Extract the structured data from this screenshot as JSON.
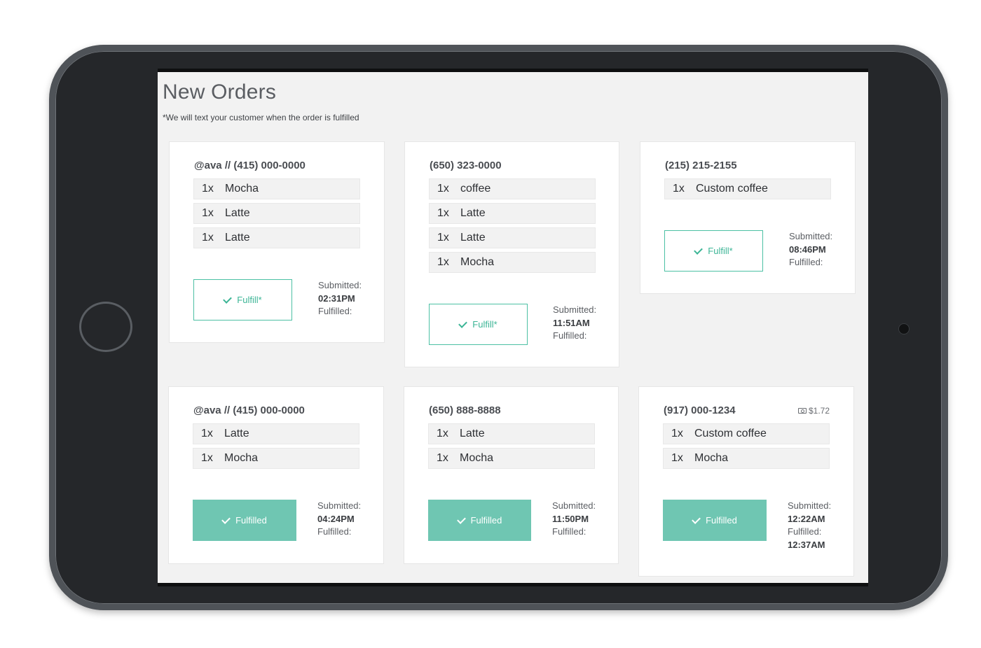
{
  "page": {
    "title": "New Orders",
    "note": "*We will text your customer when the order is fulfilled"
  },
  "labels": {
    "submitted": "Submitted:",
    "fulfilled": "Fulfilled:",
    "fulfill_button": "Fulfill*",
    "fulfilled_button": "Fulfilled"
  },
  "colors": {
    "accent": "#3cb596",
    "accent_fill": "#6fc6b2",
    "background": "#f2f2f2"
  },
  "orders": [
    {
      "customer": "@ava // (415) 000-0000",
      "items": [
        {
          "qty": "1x",
          "name": "Mocha"
        },
        {
          "qty": "1x",
          "name": "Latte"
        },
        {
          "qty": "1x",
          "name": "Latte"
        }
      ],
      "status": "pending",
      "submitted": "02:31PM",
      "fulfilled": ""
    },
    {
      "customer": "(650) 323-0000",
      "items": [
        {
          "qty": "1x",
          "name": "coffee"
        },
        {
          "qty": "1x",
          "name": "Latte"
        },
        {
          "qty": "1x",
          "name": "Latte"
        },
        {
          "qty": "1x",
          "name": "Mocha"
        }
      ],
      "status": "pending",
      "submitted": "11:51AM",
      "fulfilled": ""
    },
    {
      "customer": "(215) 215-2155",
      "items": [
        {
          "qty": "1x",
          "name": "Custom coffee"
        }
      ],
      "status": "pending",
      "submitted": "08:46PM",
      "fulfilled": ""
    },
    {
      "customer": "@ava // (415) 000-0000",
      "items": [
        {
          "qty": "1x",
          "name": "Latte"
        },
        {
          "qty": "1x",
          "name": "Mocha"
        }
      ],
      "status": "fulfilled",
      "submitted": "04:24PM",
      "fulfilled": ""
    },
    {
      "customer": "(650) 888-8888",
      "items": [
        {
          "qty": "1x",
          "name": "Latte"
        },
        {
          "qty": "1x",
          "name": "Mocha"
        }
      ],
      "status": "fulfilled",
      "submitted": "11:50PM",
      "fulfilled": ""
    },
    {
      "customer": "(917) 000-1234",
      "tip": "$1.72",
      "tip_icon": "cash-icon",
      "items": [
        {
          "qty": "1x",
          "name": "Custom coffee"
        },
        {
          "qty": "1x",
          "name": "Mocha"
        }
      ],
      "status": "fulfilled",
      "submitted": "12:22AM",
      "fulfilled": "12:37AM"
    }
  ]
}
